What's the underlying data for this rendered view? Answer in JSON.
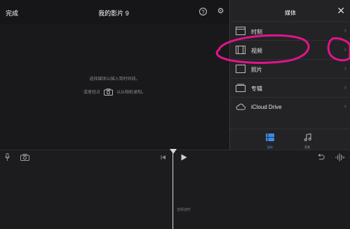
{
  "topbar": {
    "done_label": "完成",
    "title": "我的影片 9",
    "help_icon_glyph": "?",
    "settings_icon_glyph": "⚙"
  },
  "viewer": {
    "hint_line1": "选择媒体以插入到时间线。",
    "hint_line2_before": "或者轻点",
    "hint_line2_after": "以从相机录制。"
  },
  "media_panel": {
    "title": "媒体",
    "close_glyph": "✕",
    "chevron_glyph": "›",
    "items": [
      {
        "label": "时刻",
        "icon": "moments-icon"
      },
      {
        "label": "视频",
        "icon": "video-icon"
      },
      {
        "label": "照片",
        "icon": "photos-icon"
      },
      {
        "label": "专辑",
        "icon": "album-icon"
      },
      {
        "label": "iCloud Drive",
        "icon": "cloud-icon"
      }
    ],
    "tabs": [
      {
        "label": "媒体",
        "icon": "media-icon",
        "active": true
      },
      {
        "label": "音频",
        "icon": "music-icon",
        "active": false
      }
    ]
  },
  "timeline": {
    "label": "音频波形"
  },
  "colors": {
    "background": "#1b1b1d",
    "panel": "#232325",
    "accent": "#3d8be8",
    "annotation": "#e0148c"
  }
}
